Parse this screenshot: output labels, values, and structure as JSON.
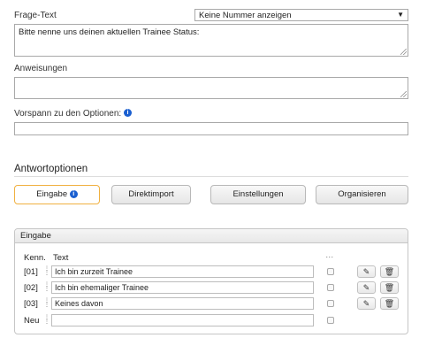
{
  "question": {
    "label": "Frage-Text",
    "number_select": "Keine Nummer anzeigen",
    "text": "Bitte nenne uns deinen aktuellen Trainee Status:"
  },
  "instructions": {
    "label": "Anweisungen",
    "text": ""
  },
  "preface": {
    "label": "Vorspann zu den Optionen:",
    "text": ""
  },
  "answer_options": {
    "title": "Antwortoptionen",
    "buttons": [
      "Eingabe",
      "Direktimport",
      "Einstellungen",
      "Organisieren"
    ]
  },
  "input_panel": {
    "title": "Eingabe",
    "col_code": "Kenn.",
    "col_text": "Text",
    "col_extra": "…",
    "rows": [
      {
        "code": "[01]",
        "text": "Ich bin zurzeit Trainee"
      },
      {
        "code": "[02]",
        "text": "Ich bin ehemaliger Trainee"
      },
      {
        "code": "[03]",
        "text": "Keines davon"
      }
    ],
    "new_label": "Neu"
  },
  "icons": {
    "info": "info-icon",
    "edit": "edit-icon",
    "delete": "trash-icon",
    "drag": "drag-handle-icon",
    "dropdown": "chevron-down-icon"
  }
}
